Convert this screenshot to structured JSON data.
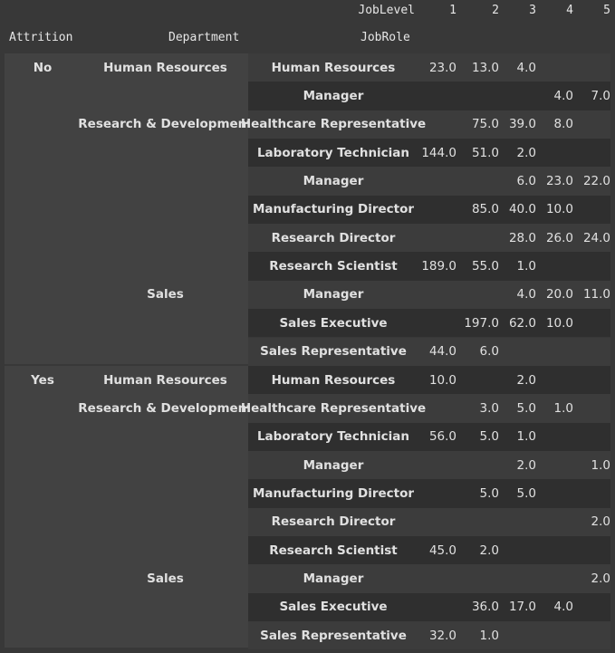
{
  "header": {
    "columns_name": "JobLevel",
    "levels": [
      "1",
      "2",
      "3",
      "4",
      "5"
    ],
    "index_names": [
      "Attrition",
      "Department",
      "JobRole"
    ]
  },
  "groups": [
    {
      "attrition": "No",
      "departments": [
        {
          "name": "Human Resources",
          "rows": [
            {
              "role": "Human Resources",
              "values": [
                "23.0",
                "13.0",
                "4.0",
                "",
                ""
              ]
            },
            {
              "role": "Manager",
              "values": [
                "",
                "",
                "",
                "4.0",
                "7.0"
              ]
            }
          ]
        },
        {
          "name": "Research & Development",
          "rows": [
            {
              "role": "Healthcare Representative",
              "values": [
                "",
                "75.0",
                "39.0",
                "8.0",
                ""
              ]
            },
            {
              "role": "Laboratory Technician",
              "values": [
                "144.0",
                "51.0",
                "2.0",
                "",
                ""
              ]
            },
            {
              "role": "Manager",
              "values": [
                "",
                "",
                "6.0",
                "23.0",
                "22.0"
              ]
            },
            {
              "role": "Manufacturing Director",
              "values": [
                "",
                "85.0",
                "40.0",
                "10.0",
                ""
              ]
            },
            {
              "role": "Research Director",
              "values": [
                "",
                "",
                "28.0",
                "26.0",
                "24.0"
              ]
            },
            {
              "role": "Research Scientist",
              "values": [
                "189.0",
                "55.0",
                "1.0",
                "",
                ""
              ]
            }
          ]
        },
        {
          "name": "Sales",
          "rows": [
            {
              "role": "Manager",
              "values": [
                "",
                "",
                "4.0",
                "20.0",
                "11.0"
              ]
            },
            {
              "role": "Sales Executive",
              "values": [
                "",
                "197.0",
                "62.0",
                "10.0",
                ""
              ]
            },
            {
              "role": "Sales Representative",
              "values": [
                "44.0",
                "6.0",
                "",
                "",
                ""
              ]
            }
          ]
        }
      ]
    },
    {
      "attrition": "Yes",
      "departments": [
        {
          "name": "Human Resources",
          "rows": [
            {
              "role": "Human Resources",
              "values": [
                "10.0",
                "",
                "2.0",
                "",
                ""
              ]
            }
          ]
        },
        {
          "name": "Research & Development",
          "rows": [
            {
              "role": "Healthcare Representative",
              "values": [
                "",
                "3.0",
                "5.0",
                "1.0",
                ""
              ]
            },
            {
              "role": "Laboratory Technician",
              "values": [
                "56.0",
                "5.0",
                "1.0",
                "",
                ""
              ]
            },
            {
              "role": "Manager",
              "values": [
                "",
                "",
                "2.0",
                "",
                "1.0"
              ]
            },
            {
              "role": "Manufacturing Director",
              "values": [
                "",
                "5.0",
                "5.0",
                "",
                ""
              ]
            },
            {
              "role": "Research Director",
              "values": [
                "",
                "",
                "",
                "",
                "2.0"
              ]
            },
            {
              "role": "Research Scientist",
              "values": [
                "45.0",
                "2.0",
                "",
                "",
                ""
              ]
            }
          ]
        },
        {
          "name": "Sales",
          "rows": [
            {
              "role": "Manager",
              "values": [
                "",
                "",
                "",
                "",
                "2.0"
              ]
            },
            {
              "role": "Sales Executive",
              "values": [
                "",
                "36.0",
                "17.0",
                "4.0",
                ""
              ]
            },
            {
              "role": "Sales Representative",
              "values": [
                "32.0",
                "1.0",
                "",
                "",
                ""
              ]
            }
          ]
        }
      ]
    }
  ],
  "colors": {
    "background": "#383838",
    "index_panel": "#424242",
    "row_dark": "#2f2f2f",
    "row_light": "#3c3c3c",
    "text": "#e6e6e6"
  }
}
